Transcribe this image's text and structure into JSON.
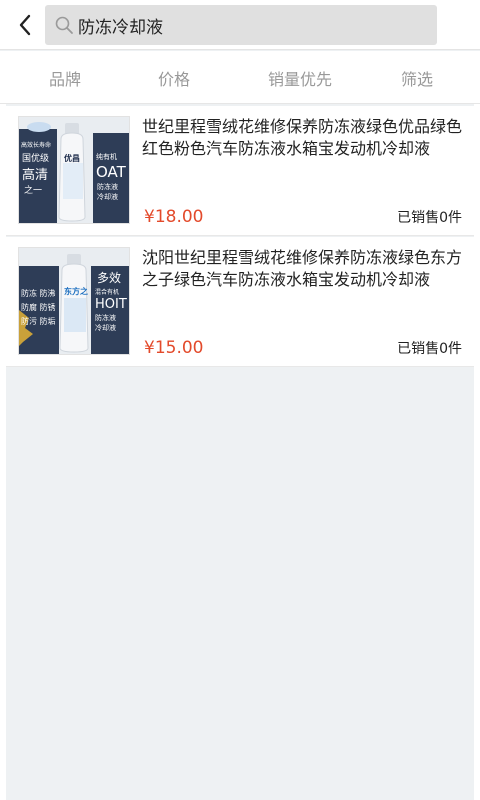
{
  "header": {
    "search_query": "防冻冷却液",
    "search_value": "防冻冷却液"
  },
  "filters": {
    "tabs": [
      {
        "label": "品牌"
      },
      {
        "label": "价格"
      },
      {
        "label": "销量优先"
      },
      {
        "label": "筛选"
      }
    ]
  },
  "products": [
    {
      "title": "世纪里程雪绒花维修保养防冻液绿色优品绿色红色粉色汽车防冻液水箱宝发动机冷却液",
      "price": "¥18.00",
      "sold": "已销售0件",
      "image": {
        "left_texts": [
          "高效长寿命",
          "国优级",
          "高清",
          "之一"
        ],
        "brand": "优昌",
        "oat": "OAT",
        "right_texts": [
          "纯有机",
          "防冻液",
          "冷却液"
        ]
      }
    },
    {
      "title": "沈阳世纪里程雪绒花维修保养防冻液绿色东方之子绿色汽车防冻液水箱宝发动机冷却液",
      "price": "¥15.00",
      "sold": "已销售0件",
      "image": {
        "left_texts": [
          "防冻 防沸",
          "防腐 防锈",
          "防污 防垢"
        ],
        "brand": "东方之",
        "right_texts": [
          "多效",
          "混合有机",
          "HOIT",
          "防冻液",
          "冷却液"
        ]
      }
    }
  ],
  "colors": {
    "price": "#e34a2b",
    "background": "#eef1f3",
    "accent_icon": "back-arrow-icon"
  }
}
